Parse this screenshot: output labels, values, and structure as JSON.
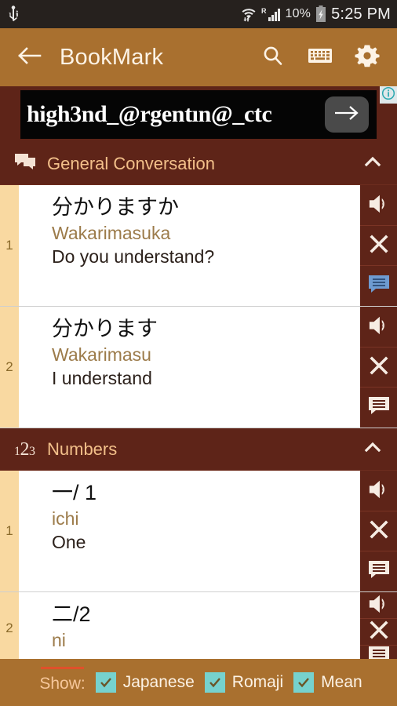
{
  "statusbar": {
    "usb_icon": "usb-icon",
    "wifi_icon": "wifi-icon",
    "roaming_letter": "R",
    "signal_icon": "signal-bars-icon",
    "battery_percent": "10%",
    "battery_icon": "battery-charging-icon",
    "time": "5:25 PM"
  },
  "appbar": {
    "back_icon": "back-arrow-icon",
    "title": "BookMark",
    "search_icon": "search-icon",
    "keyboard_icon": "keyboard-icon",
    "settings_icon": "gear-icon"
  },
  "ad": {
    "text": "high3nd_@rgentın@_ctc",
    "cta_icon": "arrow-right-icon",
    "info_icon": "info-icon"
  },
  "sections": [
    {
      "icon": "chat-bubbles-icon",
      "title": "General Conversation",
      "collapse_icon": "chevron-up-icon",
      "rows": [
        {
          "index": "1",
          "japanese": "分かりますか",
          "romaji": "Wakarimasuka",
          "meaning": "Do you understand?",
          "speaker_icon": "speaker-icon",
          "delete_icon": "close-icon",
          "note_icon": "note-icon",
          "note_active": true
        },
        {
          "index": "2",
          "japanese": "分かります",
          "romaji": "Wakarimasu",
          "meaning": "I understand",
          "speaker_icon": "speaker-icon",
          "delete_icon": "close-icon",
          "note_icon": "note-icon",
          "note_active": false
        }
      ]
    },
    {
      "icon": "123-icon",
      "icon_digits": [
        "1",
        "2",
        "3"
      ],
      "title": "Numbers",
      "collapse_icon": "chevron-up-icon",
      "rows": [
        {
          "index": "1",
          "japanese": "一/ 1",
          "romaji": "ichi",
          "meaning": "One",
          "speaker_icon": "speaker-icon",
          "delete_icon": "close-icon",
          "note_icon": "note-icon",
          "note_active": false
        },
        {
          "index": "2",
          "japanese": "二/2",
          "romaji": "ni",
          "meaning": "",
          "speaker_icon": "speaker-icon",
          "delete_icon": "close-icon",
          "note_icon": "note-icon",
          "note_active": false
        }
      ]
    }
  ],
  "footer": {
    "show_label": "Show:",
    "options": [
      {
        "label": "Japanese",
        "checked": true
      },
      {
        "label": "Romaji",
        "checked": true
      },
      {
        "label": "Mean",
        "checked": true
      }
    ]
  },
  "colors": {
    "appbar": "#A9702F",
    "section_header": "#5E2418",
    "accent_title": "#F3C08A",
    "index_strip": "#F9D9A1",
    "romaji_text": "#9C7B4A",
    "checkbox": "#76D2CE",
    "statusbar": "#26211E",
    "note_active": "#6E9BD1"
  }
}
